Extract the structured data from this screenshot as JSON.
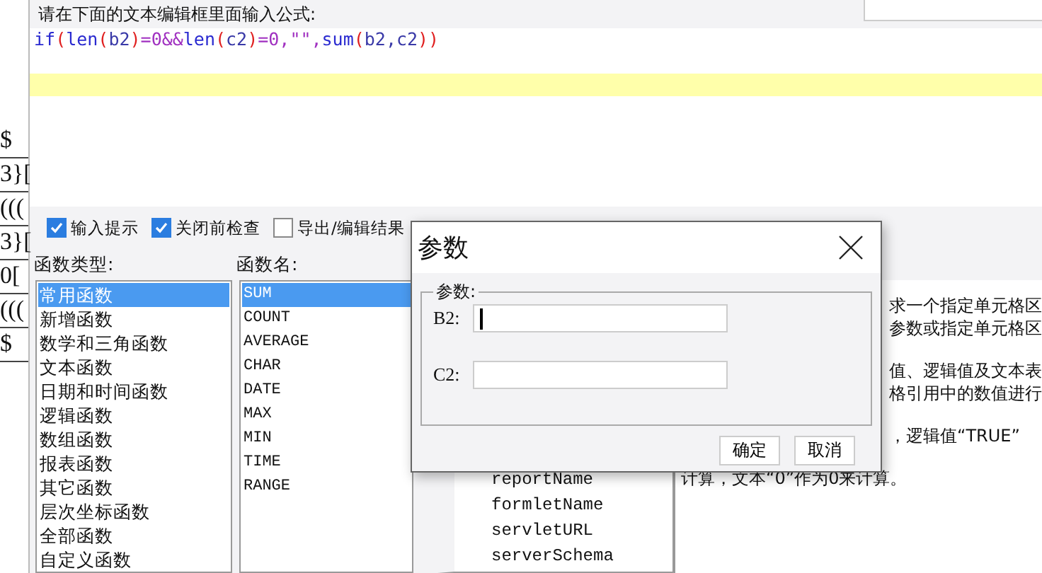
{
  "background_sheet": {
    "cells": [
      "$",
      "3}[",
      "(((",
      "3}[",
      "0[",
      "(((",
      "$"
    ]
  },
  "formula_dialog": {
    "prompt": "请在下面的文本编辑框里面输入公式:",
    "formula_tokens": [
      {
        "text": "if",
        "kind": "fn"
      },
      {
        "text": "(",
        "kind": "paren"
      },
      {
        "text": "len",
        "kind": "fn"
      },
      {
        "text": "(",
        "kind": "paren"
      },
      {
        "text": "b2",
        "kind": "arg"
      },
      {
        "text": ")",
        "kind": "paren"
      },
      {
        "text": "=0&&",
        "kind": "op"
      },
      {
        "text": "len",
        "kind": "fn"
      },
      {
        "text": "(",
        "kind": "paren"
      },
      {
        "text": "c2",
        "kind": "arg"
      },
      {
        "text": ")",
        "kind": "paren"
      },
      {
        "text": "=0,",
        "kind": "op"
      },
      {
        "text": "\"\"",
        "kind": "str"
      },
      {
        "text": ",",
        "kind": "op"
      },
      {
        "text": "sum",
        "kind": "fn"
      },
      {
        "text": "(",
        "kind": "paren"
      },
      {
        "text": "b2,c2",
        "kind": "arg"
      },
      {
        "text": "))",
        "kind": "paren"
      }
    ],
    "options": [
      {
        "label": "输入提示",
        "checked": true
      },
      {
        "label": "关闭前检查",
        "checked": true
      },
      {
        "label": "导出/编辑结果",
        "checked": false
      }
    ],
    "function_types_label": "函数类型:",
    "function_names_label": "函数名:",
    "function_types": [
      {
        "label": "常用函数",
        "selected": true
      },
      {
        "label": "新增函数",
        "selected": false
      },
      {
        "label": "数学和三角函数",
        "selected": false
      },
      {
        "label": "文本函数",
        "selected": false
      },
      {
        "label": "日期和时间函数",
        "selected": false
      },
      {
        "label": "逻辑函数",
        "selected": false
      },
      {
        "label": "数组函数",
        "selected": false
      },
      {
        "label": "报表函数",
        "selected": false
      },
      {
        "label": "其它函数",
        "selected": false
      },
      {
        "label": "层次坐标函数",
        "selected": false
      },
      {
        "label": "全部函数",
        "selected": false
      },
      {
        "label": "自定义函数",
        "selected": false
      }
    ],
    "function_names": [
      {
        "label": "SUM",
        "selected": true
      },
      {
        "label": "COUNT",
        "selected": false
      },
      {
        "label": "AVERAGE",
        "selected": false
      },
      {
        "label": "CHAR",
        "selected": false
      },
      {
        "label": "DATE",
        "selected": false
      },
      {
        "label": "MAX",
        "selected": false
      },
      {
        "label": "MIN",
        "selected": false
      },
      {
        "label": "TIME",
        "selected": false
      },
      {
        "label": "RANGE",
        "selected": false
      }
    ],
    "variables_tree": [
      "reportName",
      "formletName",
      "servletURL",
      "serverSchema"
    ],
    "description": [
      {
        "text": "求一个指定单元格区",
        "kind": "covered"
      },
      {
        "text": "参数或指定单元格区",
        "kind": "covered"
      },
      {
        "kind": "gap"
      },
      {
        "text": "值、逻辑值及文本表",
        "kind": "covered"
      },
      {
        "text": "格引用中的数值进行",
        "kind": "covered"
      },
      {
        "kind": "gap"
      },
      {
        "text": "，逻辑值“TRUE”",
        "kind": "covered"
      },
      {
        "kind": "gap"
      },
      {
        "text": "计算，文本“0”作为0来计算。",
        "kind": "full"
      }
    ]
  },
  "params_dialog": {
    "title": "参数",
    "group_label": "参数:",
    "fields": [
      {
        "label": "B2:",
        "focused": true
      },
      {
        "label": "C2:",
        "focused": false
      }
    ],
    "buttons": [
      "确定",
      "取消"
    ]
  }
}
